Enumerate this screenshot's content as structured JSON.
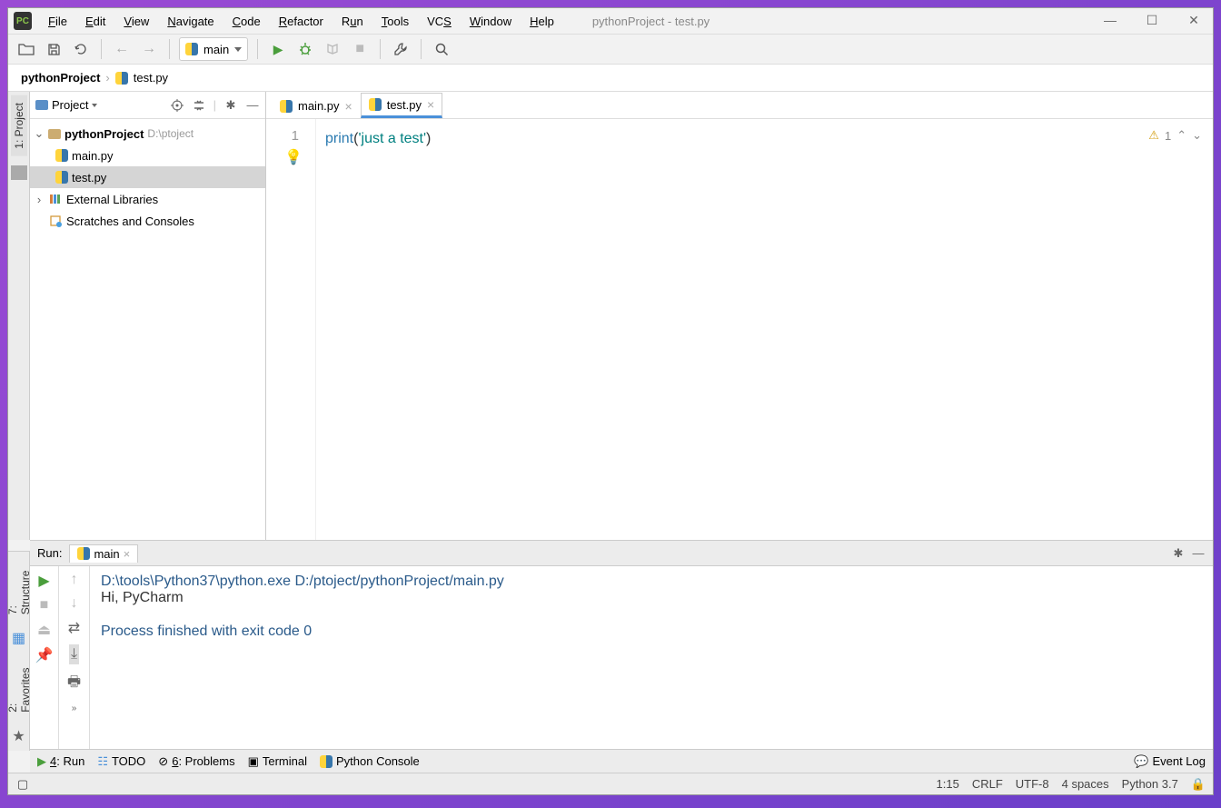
{
  "title": "pythonProject - test.py",
  "menus": [
    "File",
    "Edit",
    "View",
    "Navigate",
    "Code",
    "Refactor",
    "Run",
    "Tools",
    "VCS",
    "Window",
    "Help"
  ],
  "menus_underline": [
    "F",
    "E",
    "V",
    "N",
    "C",
    "R",
    "R",
    "T",
    "S",
    "W",
    "H"
  ],
  "toolbar": {
    "config": "main"
  },
  "breadcrumb": {
    "project": "pythonProject",
    "file": "test.py"
  },
  "sidebar": {
    "title": "Project",
    "root": {
      "name": "pythonProject",
      "path": "D:\\ptoject"
    },
    "files": [
      "main.py",
      "test.py"
    ],
    "external": "External Libraries",
    "scratches": "Scratches and Consoles"
  },
  "tabs": [
    {
      "name": "main.py",
      "active": false
    },
    {
      "name": "test.py",
      "active": true
    }
  ],
  "editor": {
    "line": "1",
    "code": {
      "fn": "print",
      "p1": "(",
      "str": "'just a test'",
      "p2": ")"
    },
    "inspection": {
      "warn": "1"
    }
  },
  "run": {
    "label": "Run:",
    "tab": "main",
    "cmd": "D:\\tools\\Python37\\python.exe D:/ptoject/pythonProject/main.py",
    "out": "Hi, PyCharm",
    "proc": "Process finished with exit code 0"
  },
  "tools": {
    "run": "4: Run",
    "todo": "TODO",
    "problems": "6: Problems",
    "terminal": "Terminal",
    "pyconsole": "Python Console",
    "eventlog": "Event Log"
  },
  "status": {
    "pos": "1:15",
    "eol": "CRLF",
    "enc": "UTF-8",
    "indent": "4 spaces",
    "interp": "Python 3.7"
  },
  "rails": {
    "project": "1: Project",
    "structure": "7: Structure",
    "favorites": "2: Favorites"
  }
}
